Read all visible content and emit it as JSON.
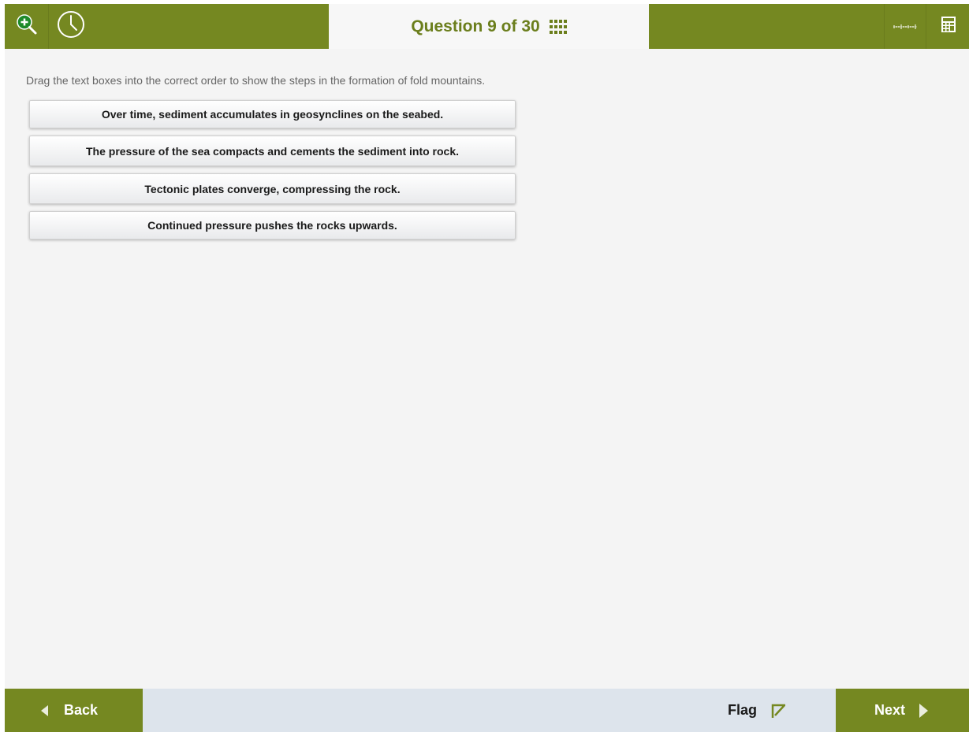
{
  "header": {
    "question_label": "Question 9 of 30",
    "icons": {
      "zoom": "zoom-in-icon",
      "timer": "clock-icon",
      "navigator": "grid-icon",
      "ruler": "ruler-icon",
      "calculator": "calculator-icon"
    }
  },
  "question": {
    "instruction": "Drag the text boxes into the correct order to show the steps in the formation of fold mountains.",
    "items": [
      "Over time, sediment accumulates in geosynclines on the seabed.",
      "The pressure of the sea compacts and cements the sediment into rock.",
      "Tectonic plates converge, compressing the rock.",
      "Continued pressure pushes the rocks upwards."
    ]
  },
  "footer": {
    "back_label": "Back",
    "flag_label": "Flag",
    "next_label": "Next"
  },
  "colors": {
    "accent": "#758821",
    "title_text": "#6b7e1c",
    "content_bg": "#f4f4f4",
    "footer_bg": "#dde4ec"
  }
}
